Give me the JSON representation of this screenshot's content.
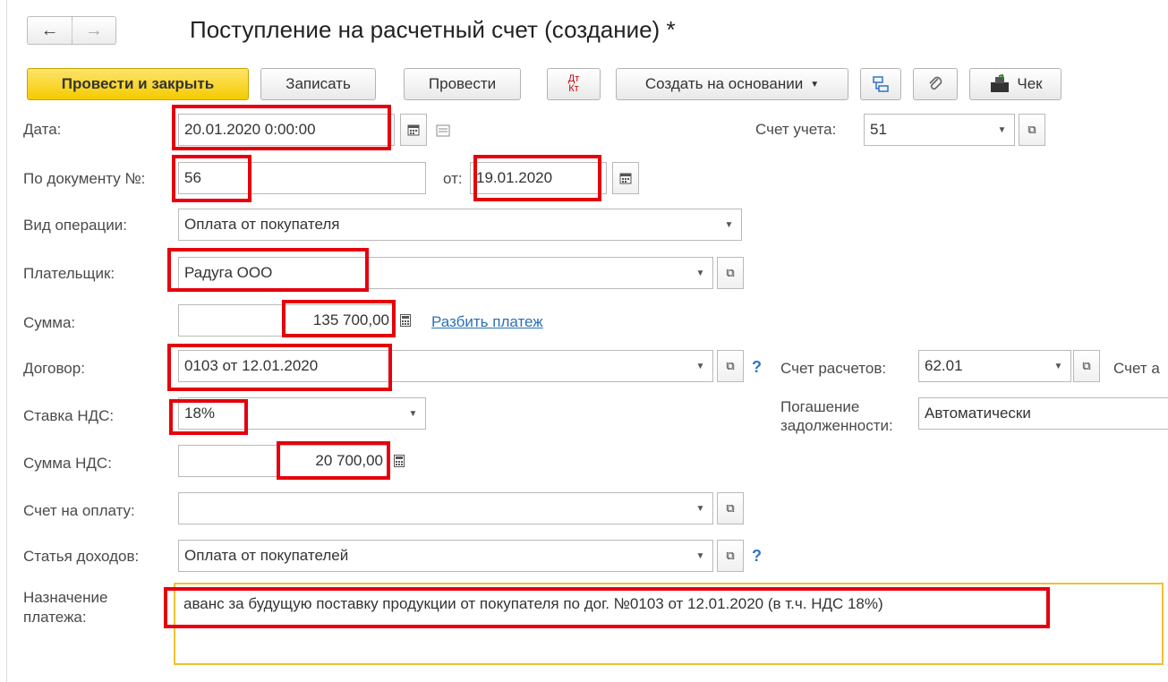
{
  "window": {
    "title": "Поступление на расчетный счет (создание) *"
  },
  "nav": {
    "back": "←",
    "forward": "→"
  },
  "toolbar": {
    "post_and_close": "Провести и закрыть",
    "save": "Записать",
    "post": "Провести",
    "dt_kt_top": "Дт",
    "dt_kt_bottom": "Кт",
    "create_based_on": "Создать на основании",
    "receipt": "Чек"
  },
  "form": {
    "date": {
      "label": "Дата:",
      "value": "20.01.2020  0:00:00"
    },
    "account": {
      "label": "Счет учета:",
      "value": "51"
    },
    "doc_number": {
      "label": "По документу №:",
      "value": "56"
    },
    "doc_date": {
      "label": "от:",
      "value": "19.01.2020"
    },
    "operation_type": {
      "label": "Вид операции:",
      "value": "Оплата от покупателя"
    },
    "payer": {
      "label": "Плательщик:",
      "value": "Радуга ООО"
    },
    "amount": {
      "label": "Сумма:",
      "value": "135 700,00",
      "split_link": "Разбить платеж"
    },
    "contract": {
      "label": "Договор:",
      "value": "0103 от 12.01.2020"
    },
    "settlement_account": {
      "label": "Счет расчетов:",
      "value": "62.01"
    },
    "advance_account": {
      "label": "Счет а"
    },
    "vat_rate": {
      "label": "Ставка НДС:",
      "value": "18%"
    },
    "debt_repayment": {
      "label_line1": "Погашение",
      "label_line2": "задолженности:",
      "value": "Автоматически"
    },
    "vat_amount": {
      "label": "Сумма НДС:",
      "value": "20 700,00"
    },
    "invoice": {
      "label": "Счет на оплату:",
      "value": ""
    },
    "income_item": {
      "label": "Статья доходов:",
      "value": "Оплата от покупателей"
    },
    "purpose": {
      "label_line1": "Назначение",
      "label_line2": "платежа:",
      "value": "аванс за будущую поставку продукции от покупателя по дог. №0103 от 12.01.2020 (в т.ч. НДС 18%)"
    }
  },
  "help_mark": "?",
  "colors": {
    "primary_button": "#f4cb00",
    "highlight": "#e5000c",
    "link": "#2a6fba",
    "focus": "#f0c030"
  }
}
